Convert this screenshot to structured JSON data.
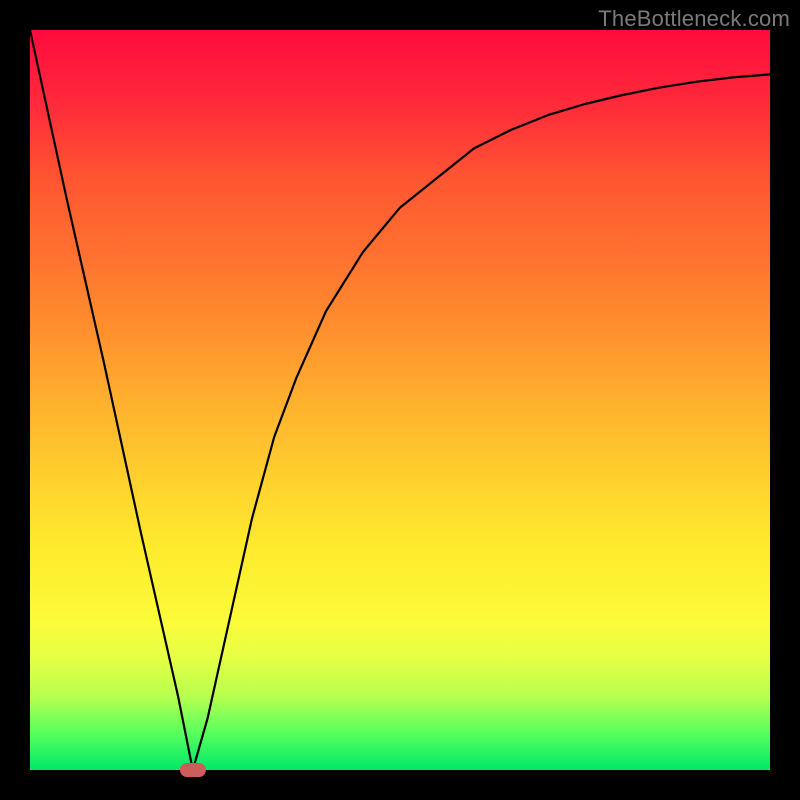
{
  "watermark": "TheBottleneck.com",
  "chart_data": {
    "type": "line",
    "title": "",
    "xlabel": "",
    "ylabel": "",
    "xlim": [
      0,
      100
    ],
    "ylim": [
      0,
      100
    ],
    "grid": false,
    "series": [
      {
        "name": "bottleneck-curve",
        "x": [
          0,
          5,
          10,
          15,
          20,
          22,
          24,
          26,
          28,
          30,
          33,
          36,
          40,
          45,
          50,
          55,
          60,
          65,
          70,
          75,
          80,
          85,
          90,
          95,
          100
        ],
        "values": [
          100,
          77,
          55,
          32,
          10,
          0,
          7,
          16,
          25,
          34,
          45,
          53,
          62,
          70,
          76,
          80,
          84,
          86.5,
          88.5,
          90,
          91.2,
          92.2,
          93,
          93.6,
          94
        ]
      }
    ],
    "marker": {
      "x": 22,
      "y": 0,
      "color": "#cd5c5c"
    },
    "background_gradient": {
      "top": "#ff0b3e",
      "mid": "#ffce2e",
      "bottom": "#00e868"
    }
  }
}
